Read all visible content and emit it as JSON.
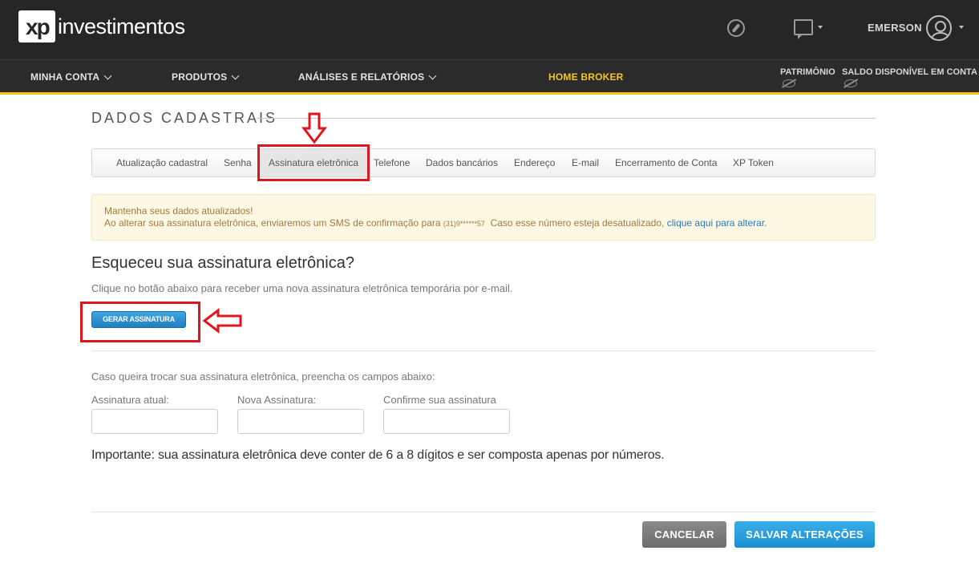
{
  "header": {
    "logo_mark": "xp",
    "logo_text": "investimentos",
    "user_name": "EMERSON"
  },
  "nav": {
    "items": [
      {
        "label": "MINHA CONTA"
      },
      {
        "label": "PRODUTOS"
      },
      {
        "label": "ANÁLISES E RELATÓRIOS"
      },
      {
        "label": "HOME BROKER"
      }
    ],
    "patrimonio_label": "PATRIMÔNIO",
    "saldo_label": "SALDO DISPONÍVEL EM CONTA"
  },
  "page": {
    "title": "DADOS CADASTRAIS",
    "tabs": [
      {
        "label": "Atualização cadastral"
      },
      {
        "label": "Senha"
      },
      {
        "label": "Assinatura eletrônica"
      },
      {
        "label": "Telefone"
      },
      {
        "label": "Dados bancários"
      },
      {
        "label": "Endereço"
      },
      {
        "label": "E-mail"
      },
      {
        "label": "Encerramento de Conta"
      },
      {
        "label": "XP Token"
      }
    ],
    "alert": {
      "line1": "Mantenha seus dados atualizados!",
      "line2_prefix": "Ao alterar sua assinatura eletrônica, enviaremos um SMS de confirmação para ",
      "phone": "(31)9******57",
      "line2_suffix": "  Caso esse número esteja desatualizado, ",
      "link": "clique aqui para alterar",
      "period": "."
    },
    "forgot_heading": "Esqueceu sua assinatura eletrônica?",
    "forgot_desc": "Clique no botão abaixo para receber uma nova assinatura eletrônica temporária por e-mail.",
    "generate_button": "GERAR ASSINATURA",
    "change_text": "Caso queira trocar sua assinatura eletrônica, preencha os campos abaixo:",
    "fields": [
      {
        "label": "Assinatura atual:",
        "value": ""
      },
      {
        "label": "Nova Assinatura:",
        "value": ""
      },
      {
        "label": "Confirme sua assinatura",
        "value": ""
      }
    ],
    "important": "Importante: sua assinatura eletrônica deve conter de 6 a 8 dígitos e ser composta apenas por números.",
    "cancel_button": "CANCELAR",
    "save_button": "SALVAR ALTERAÇÕES"
  },
  "colors": {
    "header_bg": "#262626",
    "accent_yellow": "#f5c518",
    "primary_blue": "#1c8fd2",
    "annotation_red": "#e0161e"
  }
}
